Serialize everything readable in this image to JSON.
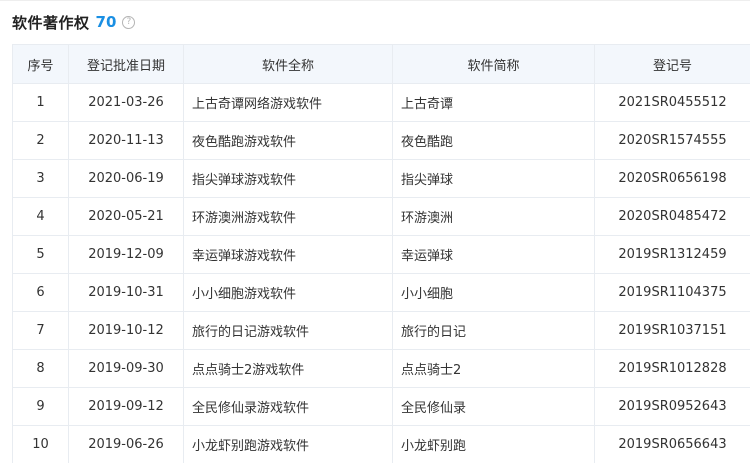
{
  "section": {
    "title": "软件著作权",
    "count": "70",
    "help_icon": "question-circle-icon"
  },
  "table": {
    "headers": [
      "序号",
      "登记批准日期",
      "软件全称",
      "软件简称",
      "登记号"
    ],
    "rows": [
      [
        "1",
        "2021-03-26",
        "上古奇谭网络游戏软件",
        "上古奇谭",
        "2021SR0455512"
      ],
      [
        "2",
        "2020-11-13",
        "夜色酷跑游戏软件",
        "夜色酷跑",
        "2020SR1574555"
      ],
      [
        "3",
        "2020-06-19",
        "指尖弹球游戏软件",
        "指尖弹球",
        "2020SR0656198"
      ],
      [
        "4",
        "2020-05-21",
        "环游澳洲游戏软件",
        "环游澳洲",
        "2020SR0485472"
      ],
      [
        "5",
        "2019-12-09",
        "幸运弹球游戏软件",
        "幸运弹球",
        "2019SR1312459"
      ],
      [
        "6",
        "2019-10-31",
        "小小细胞游戏软件",
        "小小细胞",
        "2019SR1104375"
      ],
      [
        "7",
        "2019-10-12",
        "旅行的日记游戏软件",
        "旅行的日记",
        "2019SR1037151"
      ],
      [
        "8",
        "2019-09-30",
        "点点骑士2游戏软件",
        "点点骑士2",
        "2019SR1012828"
      ],
      [
        "9",
        "2019-09-12",
        "全民修仙录游戏软件",
        "全民修仙录",
        "2019SR0952643"
      ],
      [
        "10",
        "2019-06-26",
        "小龙虾别跑游戏软件",
        "小龙虾别跑",
        "2019SR0656643"
      ]
    ]
  },
  "colors": {
    "accent": "#1a8fe3",
    "header_bg": "#f3f7fc",
    "border": "#e8ecf1"
  }
}
